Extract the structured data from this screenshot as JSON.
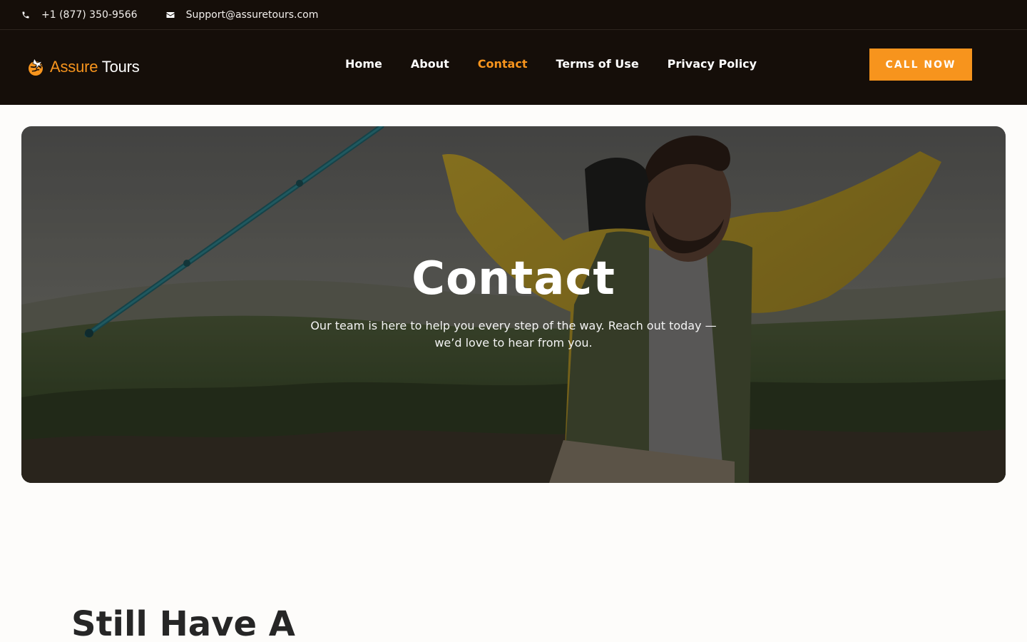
{
  "topbar": {
    "phone": "+1 (877) 350-9566",
    "email": "Support@assuretours.com"
  },
  "header": {
    "logo": {
      "brand_primary": "Assure",
      "brand_secondary": "Tours"
    },
    "nav": [
      {
        "label": "Home",
        "active": false
      },
      {
        "label": "About",
        "active": false
      },
      {
        "label": "Contact",
        "active": true
      },
      {
        "label": "Terms of Use",
        "active": false
      },
      {
        "label": "Privacy Policy",
        "active": false
      }
    ],
    "cta_label": "CALL NOW"
  },
  "hero": {
    "title": "Contact",
    "subtitle": "Our team is here to help you every step of the way. Reach out today — we’d love to hear from you."
  },
  "section": {
    "heading": "Still Have A"
  },
  "colors": {
    "accent": "#f7941d",
    "header_bg": "#150e09",
    "page_bg": "#fdfcfa"
  },
  "icons": [
    "phone-icon",
    "mail-icon",
    "logo-icon"
  ]
}
